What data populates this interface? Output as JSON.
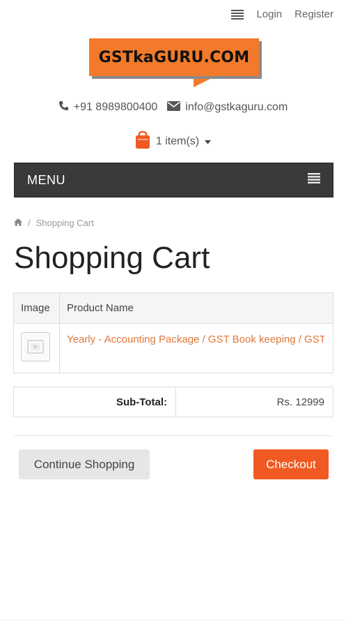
{
  "header": {
    "login_label": "Login",
    "register_label": "Register",
    "logo_text": "GSTkaGURU.COM",
    "phone": "+91 8989800400",
    "email": "info@gstkaguru.com",
    "cart_label": "1 item(s)"
  },
  "menu": {
    "label": "MENU"
  },
  "breadcrumb": {
    "current": "Shopping Cart"
  },
  "page": {
    "title": "Shopping Cart"
  },
  "cart_table": {
    "headers": {
      "image": "Image",
      "product_name": "Product Name"
    },
    "rows": [
      {
        "product_name": "Yearly - Accounting Package / GST Book keeping / GST"
      }
    ]
  },
  "totals": {
    "subtotal_label": "Sub-Total:",
    "subtotal_value": "Rs. 12999"
  },
  "actions": {
    "continue_label": "Continue Shopping",
    "checkout_label": "Checkout"
  },
  "colors": {
    "accent": "#f05a22",
    "logo_bg": "#f27a2a",
    "link": "#e0783a",
    "menu_bar": "#3a3a3a"
  },
  "icons": [
    "hamburger-icon",
    "phone-icon",
    "envelope-icon",
    "shopping-bag-icon",
    "caret-down-icon",
    "home-icon",
    "image-placeholder-icon"
  ]
}
